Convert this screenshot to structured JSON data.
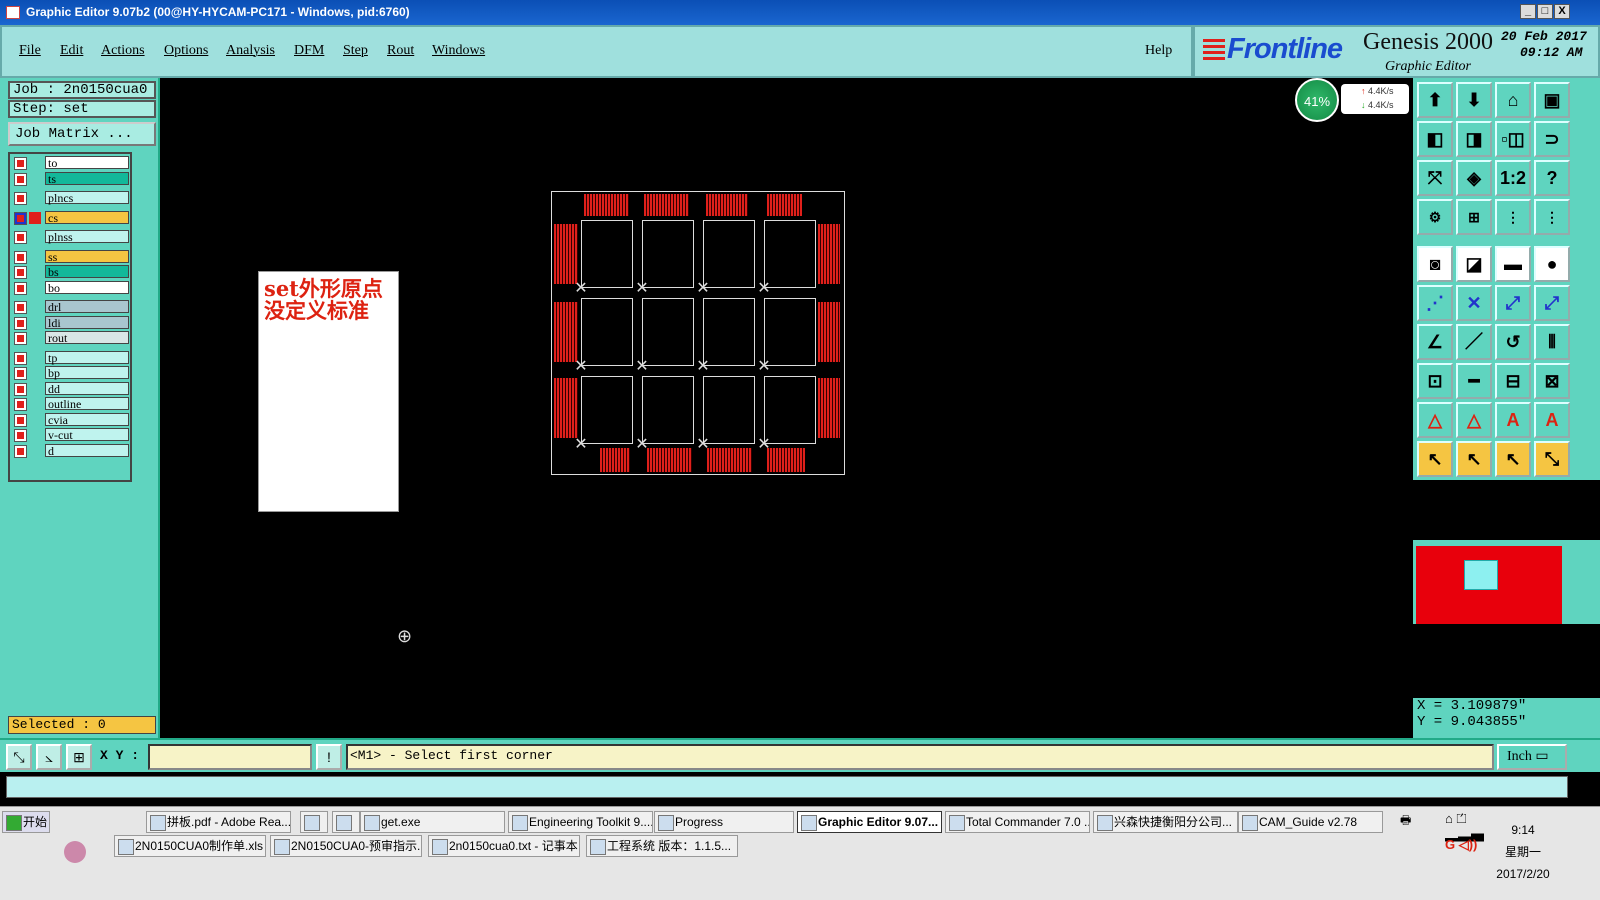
{
  "window": {
    "title": "Graphic Editor 9.07b2 (00@HY-HYCAM-PC171 - Windows, pid:6760)",
    "btn_min": "_",
    "btn_max": "□",
    "btn_close": "X"
  },
  "menu": {
    "items": [
      "File",
      "Edit",
      "Actions",
      "Options",
      "Analysis",
      "DFM",
      "Step",
      "Rout",
      "Windows"
    ],
    "help": "Help"
  },
  "brand": {
    "logo": "Frontline",
    "product": "Genesis 2000",
    "subtitle": "Graphic Editor",
    "date": "20 Feb 2017",
    "time": "09:12 AM"
  },
  "job": {
    "job_line": "Job  :  2n0150cua0",
    "step_line": "Step:  set",
    "matrix_btn": "Job Matrix ..."
  },
  "layers": [
    {
      "name": "to",
      "color": "#ffffff"
    },
    {
      "name": "ts",
      "color": "#13b89a"
    },
    {
      "name": "plncs",
      "color": "#bff3ee"
    },
    {
      "name": "cs",
      "color": "#f5c542"
    },
    {
      "name": "plnss",
      "color": "#bff3ee"
    },
    {
      "name": "ss",
      "color": "#f5c542"
    },
    {
      "name": "bs",
      "color": "#13b89a"
    },
    {
      "name": "bo",
      "color": "#ffffff"
    },
    {
      "name": "drl",
      "color": "#a9c6cf"
    },
    {
      "name": "ldi",
      "color": "#a9c6cf"
    },
    {
      "name": "rout",
      "color": "#d9e6e6"
    },
    {
      "name": "tp",
      "color": "#bff3ee"
    },
    {
      "name": "bp",
      "color": "#bff3ee"
    },
    {
      "name": "dd",
      "color": "#bff3ee"
    },
    {
      "name": "outline",
      "color": "#bff3ee"
    },
    {
      "name": "cvia",
      "color": "#bff3ee"
    },
    {
      "name": "v-cut",
      "color": "#bff3ee"
    },
    {
      "name": "d",
      "color": "#bff3ee"
    }
  ],
  "selected": "Selected : 0",
  "note": {
    "text": "set外形原点没定义标准"
  },
  "netmon": {
    "percent": "41%",
    "up": "4.4K/s",
    "down": "4.4K/s"
  },
  "coords": {
    "x": "X = 3.109879\"",
    "y": "Y = 9.043855\""
  },
  "command": {
    "xy_label": "X Y :",
    "xy_value": "",
    "prompt": "<M1> - Select first corner",
    "units": "Inch"
  },
  "toolbar_icons": [
    "open-step-icon",
    "save-icon",
    "home-icon",
    "window-icon",
    "zoom-left-icon",
    "zoom-right-icon",
    "pan-icon",
    "redraw-icon",
    "fit-icon",
    "zoom-icon",
    "scale-1-2-icon",
    "help-icon",
    "settings-icon",
    "grid-icon",
    "layer-a-icon",
    "layer-b-icon",
    "snap-center-icon",
    "snap-corner-icon",
    "ruler-icon",
    "dot-icon",
    "connect-icon",
    "intersect-icon",
    "measure-icon",
    "measure-b-icon",
    "angle-icon",
    "line-icon",
    "arc-icon",
    "mirror-icon",
    "copy-icon",
    "hline-icon",
    "resize-icon",
    "shapes-icon",
    "triangle-a-icon",
    "triangle-b-icon",
    "triangle-c-icon",
    "triangle-d-icon",
    "select-icon",
    "select-b-icon",
    "select-c-icon",
    "select-net-icon"
  ],
  "taskbar": {
    "start": "开始",
    "row1": [
      "拼板.pdf - Adobe Rea...",
      "",
      "",
      "get.exe",
      "Engineering Toolkit 9....",
      "Progress",
      "Graphic Editor 9.07...",
      "Total Commander 7.0 ...",
      "兴森快捷衡阳分公司...",
      "CAM_Guide v2.78"
    ],
    "row2": [
      "2N0150CUA0制作单.xls ...",
      "2N0150CUA0-预审指示....",
      "2n0150cua0.txt - 记事本",
      "工程系统   版本：1.1.5..."
    ],
    "clock_time": "9:14",
    "clock_day": "星期一",
    "clock_date": "2017/2/20"
  },
  "colors": {
    "accent": "#5fd4bf",
    "pad_red": "#e0201b",
    "prompt_bg": "#f7f3c7"
  }
}
